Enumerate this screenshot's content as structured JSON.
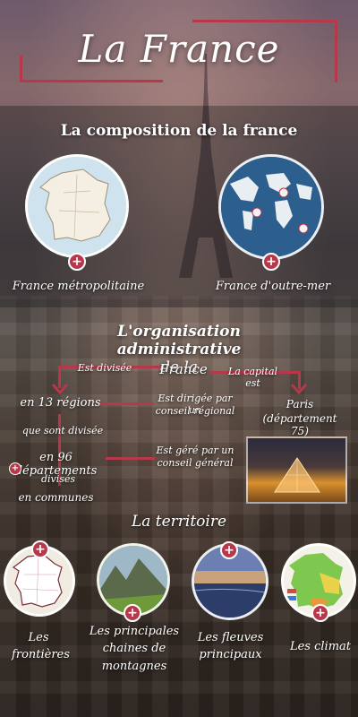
{
  "title": "La France",
  "composition": {
    "heading": "La composition de la france",
    "items": [
      {
        "label": "France métropolitaine",
        "icon": "france-map-icon"
      },
      {
        "label": "France d'outre-mer",
        "icon": "world-map-icon"
      }
    ]
  },
  "organisation": {
    "heading_line1": "L'organisation administrative",
    "heading_line2": "de la",
    "heading_line3": "France",
    "est_divisee": "Est divisée",
    "capital_label": "La capital est",
    "paris": "Paris",
    "paris_dept": "(département 75)",
    "regions": "en 13 régions",
    "regions_gov_line1": "Est dirigée par un",
    "regions_gov_line2": "conseil régional",
    "que_sont_divisee": "que sont divisée",
    "departements": "en 96 départements",
    "dept_gov_line1": "Est géré par un",
    "dept_gov_line2": "conseil général",
    "divises": "divisés",
    "communes": "en communes"
  },
  "territoire": {
    "heading": "La territoire",
    "items": [
      {
        "label_line1": "Les",
        "label_line2": "frontières",
        "label_line3": ""
      },
      {
        "label_line1": "Les principales",
        "label_line2": "chaines de",
        "label_line3": "montagnes"
      },
      {
        "label_line1": "Les fleuves",
        "label_line2": "principaux",
        "label_line3": ""
      },
      {
        "label_line1": "Les climat",
        "label_line2": "",
        "label_line3": ""
      }
    ]
  },
  "colors": {
    "accent": "#b6384a"
  }
}
